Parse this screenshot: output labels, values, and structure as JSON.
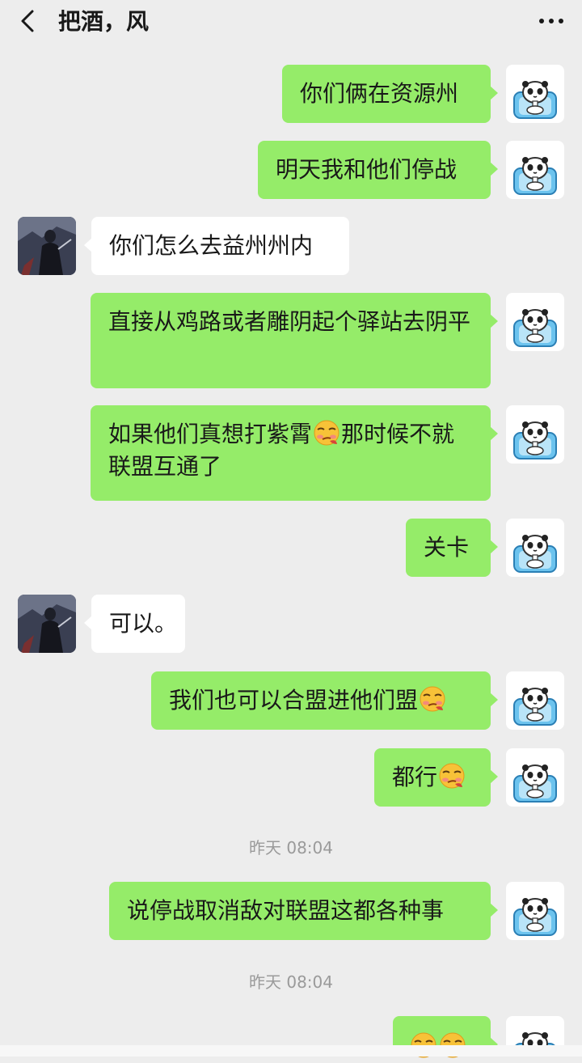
{
  "header": {
    "title": "把酒，风"
  },
  "messages": [
    {
      "text": "你们俩在资源州"
    },
    {
      "text": "明天我和他们停战"
    },
    {
      "text": "你们怎么去益州州内"
    },
    {
      "text": "直接从鸡路或者雕阴起个驿站去阴平"
    },
    {
      "text_a": "如果他们真想打紫霄",
      "text_b": "那时候不就联盟互通了"
    },
    {
      "text": "关卡"
    },
    {
      "text": "可以。"
    },
    {
      "text": "我们也可以合盟进他们盟"
    },
    {
      "text": "都行"
    },
    {
      "text": "说停战取消敌对联盟这都各种事"
    }
  ],
  "timestamps": [
    "昨天 08:04",
    "昨天 08:04"
  ],
  "icons": {
    "back": "chevron-left-icon",
    "more": "more-dots-icon",
    "emoji": "smirk-emoji-icon",
    "my_avatar": "panda-avatar",
    "contact_avatar": "dark-warrior-avatar"
  },
  "colors": {
    "my_bubble": "#95ec69",
    "other_bubble": "#ffffff",
    "background": "#ededed"
  }
}
